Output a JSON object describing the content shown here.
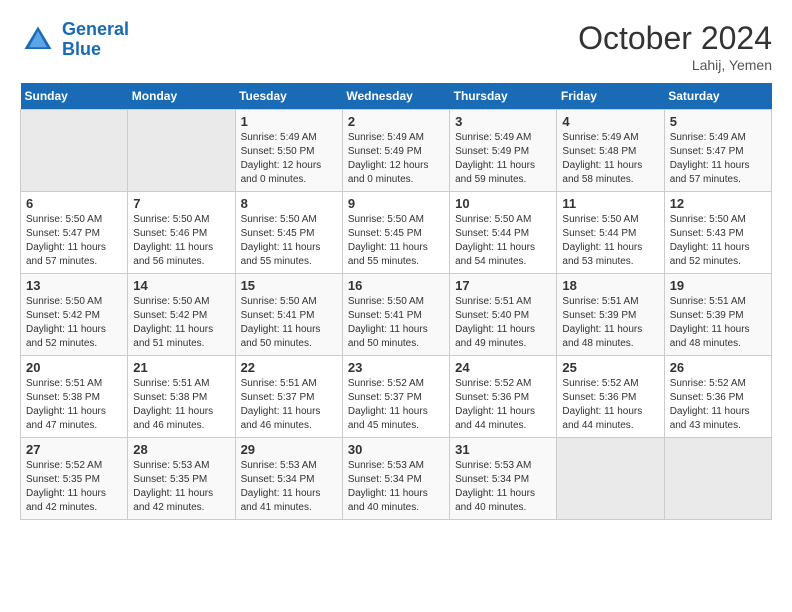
{
  "header": {
    "logo_line1": "General",
    "logo_line2": "Blue",
    "month_title": "October 2024",
    "subtitle": "Lahij, Yemen"
  },
  "weekdays": [
    "Sunday",
    "Monday",
    "Tuesday",
    "Wednesday",
    "Thursday",
    "Friday",
    "Saturday"
  ],
  "weeks": [
    [
      {
        "day": "",
        "info": ""
      },
      {
        "day": "",
        "info": ""
      },
      {
        "day": "1",
        "info": "Sunrise: 5:49 AM\nSunset: 5:50 PM\nDaylight: 12 hours\nand 0 minutes."
      },
      {
        "day": "2",
        "info": "Sunrise: 5:49 AM\nSunset: 5:49 PM\nDaylight: 12 hours\nand 0 minutes."
      },
      {
        "day": "3",
        "info": "Sunrise: 5:49 AM\nSunset: 5:49 PM\nDaylight: 11 hours\nand 59 minutes."
      },
      {
        "day": "4",
        "info": "Sunrise: 5:49 AM\nSunset: 5:48 PM\nDaylight: 11 hours\nand 58 minutes."
      },
      {
        "day": "5",
        "info": "Sunrise: 5:49 AM\nSunset: 5:47 PM\nDaylight: 11 hours\nand 57 minutes."
      }
    ],
    [
      {
        "day": "6",
        "info": "Sunrise: 5:50 AM\nSunset: 5:47 PM\nDaylight: 11 hours\nand 57 minutes."
      },
      {
        "day": "7",
        "info": "Sunrise: 5:50 AM\nSunset: 5:46 PM\nDaylight: 11 hours\nand 56 minutes."
      },
      {
        "day": "8",
        "info": "Sunrise: 5:50 AM\nSunset: 5:45 PM\nDaylight: 11 hours\nand 55 minutes."
      },
      {
        "day": "9",
        "info": "Sunrise: 5:50 AM\nSunset: 5:45 PM\nDaylight: 11 hours\nand 55 minutes."
      },
      {
        "day": "10",
        "info": "Sunrise: 5:50 AM\nSunset: 5:44 PM\nDaylight: 11 hours\nand 54 minutes."
      },
      {
        "day": "11",
        "info": "Sunrise: 5:50 AM\nSunset: 5:44 PM\nDaylight: 11 hours\nand 53 minutes."
      },
      {
        "day": "12",
        "info": "Sunrise: 5:50 AM\nSunset: 5:43 PM\nDaylight: 11 hours\nand 52 minutes."
      }
    ],
    [
      {
        "day": "13",
        "info": "Sunrise: 5:50 AM\nSunset: 5:42 PM\nDaylight: 11 hours\nand 52 minutes."
      },
      {
        "day": "14",
        "info": "Sunrise: 5:50 AM\nSunset: 5:42 PM\nDaylight: 11 hours\nand 51 minutes."
      },
      {
        "day": "15",
        "info": "Sunrise: 5:50 AM\nSunset: 5:41 PM\nDaylight: 11 hours\nand 50 minutes."
      },
      {
        "day": "16",
        "info": "Sunrise: 5:50 AM\nSunset: 5:41 PM\nDaylight: 11 hours\nand 50 minutes."
      },
      {
        "day": "17",
        "info": "Sunrise: 5:51 AM\nSunset: 5:40 PM\nDaylight: 11 hours\nand 49 minutes."
      },
      {
        "day": "18",
        "info": "Sunrise: 5:51 AM\nSunset: 5:39 PM\nDaylight: 11 hours\nand 48 minutes."
      },
      {
        "day": "19",
        "info": "Sunrise: 5:51 AM\nSunset: 5:39 PM\nDaylight: 11 hours\nand 48 minutes."
      }
    ],
    [
      {
        "day": "20",
        "info": "Sunrise: 5:51 AM\nSunset: 5:38 PM\nDaylight: 11 hours\nand 47 minutes."
      },
      {
        "day": "21",
        "info": "Sunrise: 5:51 AM\nSunset: 5:38 PM\nDaylight: 11 hours\nand 46 minutes."
      },
      {
        "day": "22",
        "info": "Sunrise: 5:51 AM\nSunset: 5:37 PM\nDaylight: 11 hours\nand 46 minutes."
      },
      {
        "day": "23",
        "info": "Sunrise: 5:52 AM\nSunset: 5:37 PM\nDaylight: 11 hours\nand 45 minutes."
      },
      {
        "day": "24",
        "info": "Sunrise: 5:52 AM\nSunset: 5:36 PM\nDaylight: 11 hours\nand 44 minutes."
      },
      {
        "day": "25",
        "info": "Sunrise: 5:52 AM\nSunset: 5:36 PM\nDaylight: 11 hours\nand 44 minutes."
      },
      {
        "day": "26",
        "info": "Sunrise: 5:52 AM\nSunset: 5:36 PM\nDaylight: 11 hours\nand 43 minutes."
      }
    ],
    [
      {
        "day": "27",
        "info": "Sunrise: 5:52 AM\nSunset: 5:35 PM\nDaylight: 11 hours\nand 42 minutes."
      },
      {
        "day": "28",
        "info": "Sunrise: 5:53 AM\nSunset: 5:35 PM\nDaylight: 11 hours\nand 42 minutes."
      },
      {
        "day": "29",
        "info": "Sunrise: 5:53 AM\nSunset: 5:34 PM\nDaylight: 11 hours\nand 41 minutes."
      },
      {
        "day": "30",
        "info": "Sunrise: 5:53 AM\nSunset: 5:34 PM\nDaylight: 11 hours\nand 40 minutes."
      },
      {
        "day": "31",
        "info": "Sunrise: 5:53 AM\nSunset: 5:34 PM\nDaylight: 11 hours\nand 40 minutes."
      },
      {
        "day": "",
        "info": ""
      },
      {
        "day": "",
        "info": ""
      }
    ]
  ]
}
